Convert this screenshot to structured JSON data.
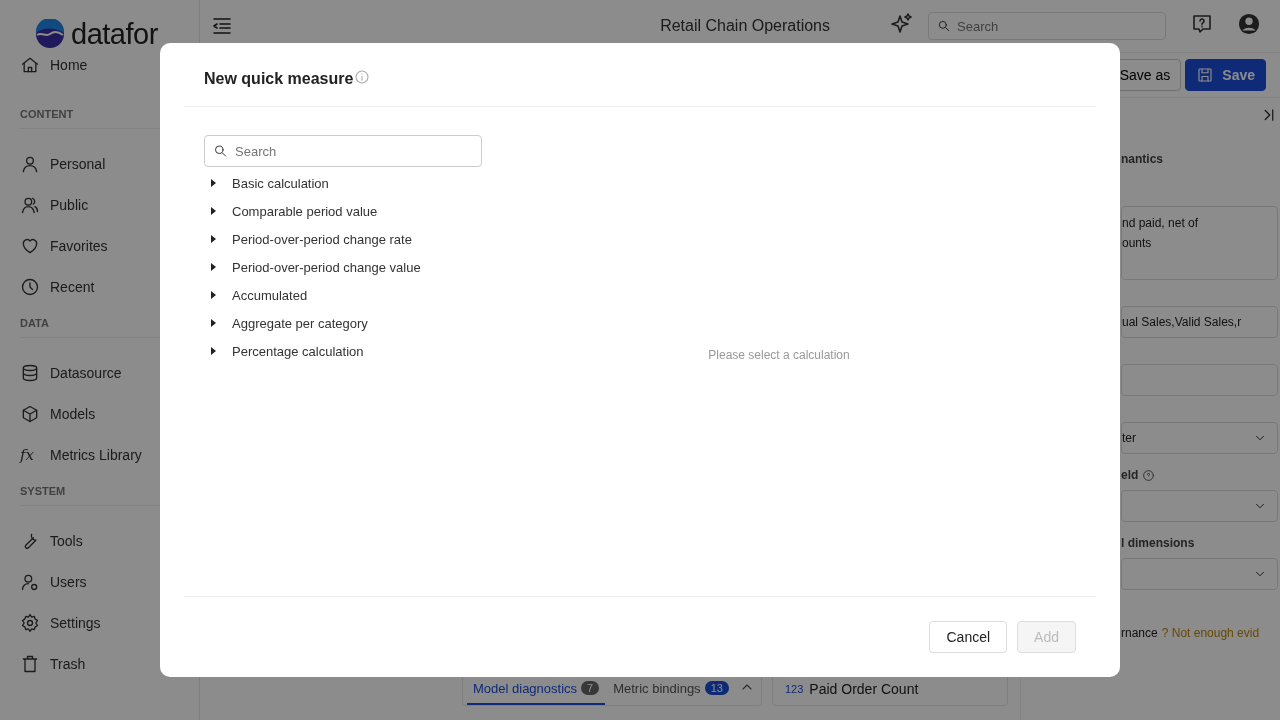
{
  "app": {
    "logo": "datafor",
    "title": "Retail Chain Operations",
    "search": {
      "placeholder": "Search"
    }
  },
  "sidebar": {
    "top_item": {
      "label": "Home"
    },
    "sections": [
      {
        "title": "CONTENT",
        "items": [
          {
            "label": "Personal"
          },
          {
            "label": "Public"
          },
          {
            "label": "Favorites"
          },
          {
            "label": "Recent"
          }
        ]
      },
      {
        "title": "DATA",
        "items": [
          {
            "label": "Datasource"
          },
          {
            "label": "Models"
          },
          {
            "label": "Metrics Library",
            "glyph": "fx"
          }
        ]
      },
      {
        "title": "SYSTEM",
        "items": [
          {
            "label": "Tools"
          },
          {
            "label": "Users"
          },
          {
            "label": "Settings"
          },
          {
            "label": "Trash"
          }
        ]
      }
    ]
  },
  "toolbar": {
    "buttons": [
      {
        "label": "Save as",
        "primary": false
      },
      {
        "label": "Save",
        "primary": true
      }
    ]
  },
  "bottom_panel": {
    "tabs": [
      {
        "label": "Model diagnostics",
        "badge": "7",
        "selected": true
      },
      {
        "label": "Metric bindings",
        "badge": "13",
        "selected": false
      }
    ],
    "field": {
      "type_tag": "123",
      "name": "Paid Order Count"
    }
  },
  "right_panel": {
    "section_title": "nantics",
    "description": [
      "nd paid, net of",
      "ounts"
    ],
    "synonyms_value": "ual Sales,Valid Sales,r",
    "select_value": "ter",
    "field_label": "eld",
    "dimensions_label": "l dimensions",
    "governance_label": "rnance",
    "governance_status": "? Not enough evid"
  },
  "dialog": {
    "title": "New quick measure",
    "search": {
      "placeholder": "Search"
    },
    "calculations": [
      {
        "label": "Basic calculation",
        "expanded": false
      },
      {
        "label": "Comparable period value",
        "expanded": false
      },
      {
        "label": "Period-over-period change rate",
        "expanded": false
      },
      {
        "label": "Period-over-period change value",
        "expanded": false
      },
      {
        "label": "Accumulated",
        "expanded": false
      },
      {
        "label": "Aggregate per category",
        "expanded": false
      },
      {
        "label": "Percentage calculation",
        "expanded": false
      }
    ],
    "empty_message": "Please select a calculation",
    "buttons": [
      {
        "label": "Cancel",
        "disabled": false
      },
      {
        "label": "Add",
        "disabled": true
      }
    ]
  }
}
